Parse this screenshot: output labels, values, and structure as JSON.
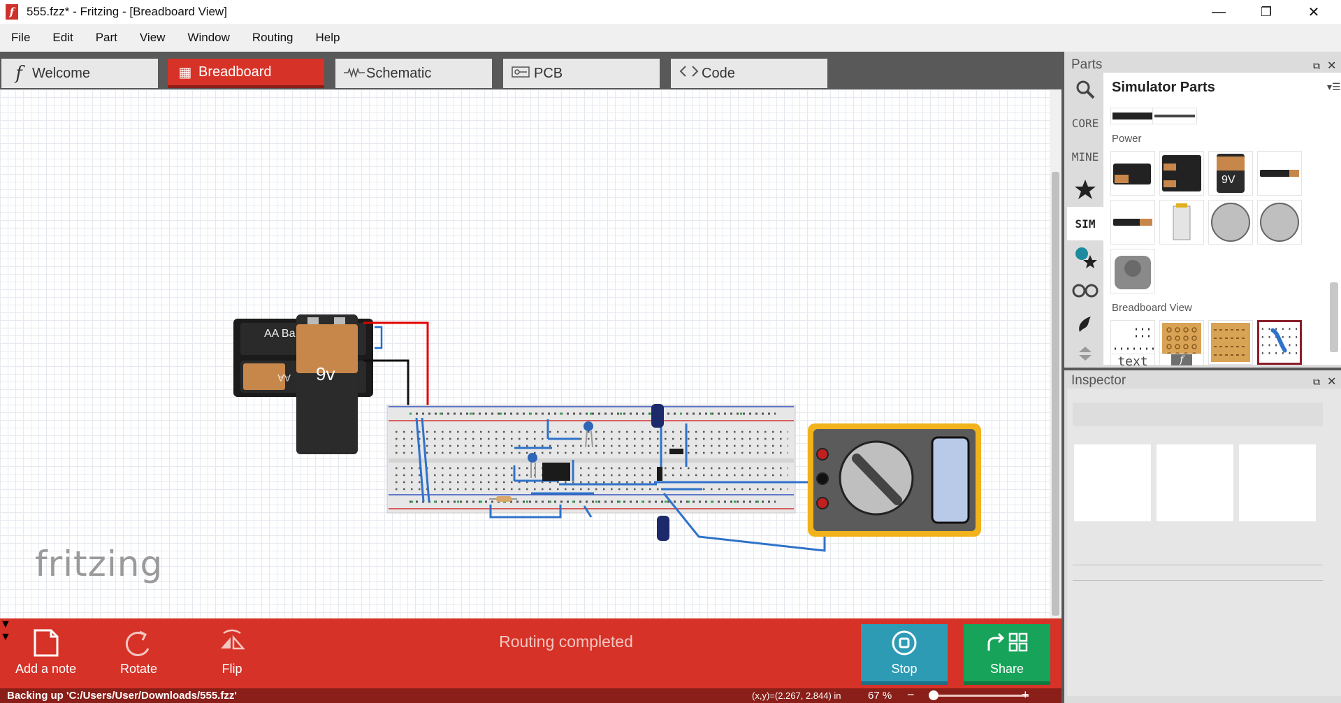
{
  "window": {
    "title": "555.fzz* - Fritzing - [Breadboard View]",
    "app_logo": "f",
    "minimize": "—",
    "maximize": "❐",
    "close": "✕"
  },
  "menu": [
    "File",
    "Edit",
    "Part",
    "View",
    "Window",
    "Routing",
    "Help"
  ],
  "tabs": [
    {
      "label": "Welcome",
      "icon": "fritzing-f-icon",
      "glyph": "f"
    },
    {
      "label": "Breadboard",
      "icon": "breadboard-icon",
      "glyph": "▦"
    },
    {
      "label": "Schematic",
      "icon": "resistor-icon",
      "glyph": "⊸"
    },
    {
      "label": "PCB",
      "icon": "pcb-icon",
      "glyph": "⊡"
    },
    {
      "label": "Code",
      "icon": "code-icon",
      "glyph": "‹›"
    }
  ],
  "active_tab": "Breadboard",
  "canvas": {
    "watermark": "fritzing",
    "battery_label": "AA Ba",
    "nine_volt_label": "9v"
  },
  "toolbar": {
    "add_note": "Add a note",
    "rotate": "Rotate",
    "flip": "Flip",
    "routing_status": "Routing completed",
    "stop": "Stop",
    "share": "Share"
  },
  "statusbar": {
    "message": "Backing up 'C:/Users/User/Downloads/555.fzz'",
    "coords": "(x,y)=(2.267, 2.844) in",
    "zoom": "67 %",
    "zoom_minus": "−",
    "zoom_plus": "+"
  },
  "parts_panel": {
    "title": "Parts",
    "bin_title": "Simulator Parts",
    "bin_tabs": [
      "CORE",
      "MINE",
      "SIM"
    ],
    "sections": [
      "Power",
      "Breadboard View"
    ],
    "tile_texts": {
      "nine_volt": "9V",
      "text": "text",
      "fritzing": "f"
    }
  },
  "inspector_panel": {
    "title": "Inspector"
  },
  "colors": {
    "accent_red": "#d73227",
    "dark_red": "#8a1e18",
    "stop_teal": "#2e9bb5",
    "share_green": "#18a35a",
    "multimeter_yellow": "#f2b21b"
  }
}
